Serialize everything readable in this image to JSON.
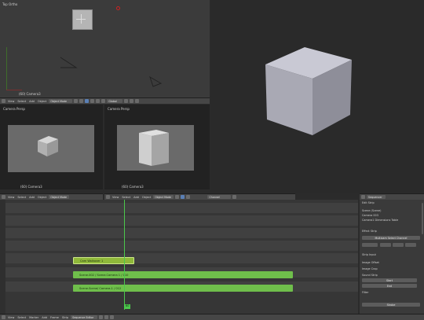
{
  "top_left_view": {
    "title": "Top Ortho",
    "object_label": "(60) Camera3"
  },
  "top_left_header": {
    "menu": [
      "View",
      "Select",
      "Add",
      "Object"
    ],
    "mode": "Object Mode",
    "pivot": "Global"
  },
  "cam_left": {
    "title": "Camera Persp",
    "object_label": "(60) Camera3"
  },
  "cam_right": {
    "title": "Camera Persp",
    "object_label": "(60) Camera3"
  },
  "mid_header": {
    "menu": [
      "View",
      "Select",
      "Add",
      "Object"
    ],
    "mode": "Object Mode",
    "menu_right": [
      "View",
      "Select",
      "Add",
      "Object"
    ],
    "mode_right": "Object Mode",
    "channel": "Channel",
    "tab": "Sequencer"
  },
  "seq": {
    "strips": [
      {
        "label": "Cam Walkover 1",
        "color": "#8fb83a"
      },
      {
        "label": "Scene.002 / Scene.Camera 1 / 010",
        "color": "#6fbf4b"
      },
      {
        "label": "Scene.Scene/ Camera.1 / 012",
        "color": "#6fbf4b"
      }
    ],
    "frame_badge": "60"
  },
  "props": {
    "header": "Sequencer",
    "rows": [
      "Edit Strip",
      "Scene (Scene)",
      "Camera 003",
      "Camera1 Dimensions Table",
      "Effect Strip",
      "Multicam Select Channel",
      "Strip Input",
      "Image Offset",
      "Image Crop",
      "Sound Strip",
      "Start",
      "End",
      "Filter",
      "Strobe"
    ]
  },
  "bottom_bar": {
    "items": [
      "View",
      "Select",
      "Marker",
      "Add",
      "Frame",
      "Strip"
    ],
    "mode": "Sequence Editor"
  }
}
